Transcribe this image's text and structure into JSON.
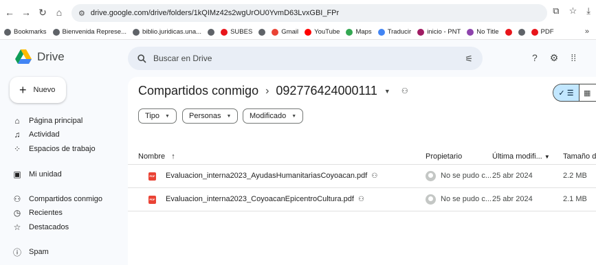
{
  "browser": {
    "url": "drive.google.com/drive/folders/1kQIMz42s2wgUrOU0YvmD63LvxGBI_FPr",
    "bookmarks": [
      {
        "label": "Bookmarks",
        "color": "#5f6368"
      },
      {
        "label": "Bienvenida Represe...",
        "color": "#5f6368"
      },
      {
        "label": "biblio.juridicas.una...",
        "color": "#5f6368"
      },
      {
        "label": "",
        "color": "#5f6368"
      },
      {
        "label": "SUBES",
        "color": "#e8151b"
      },
      {
        "label": "",
        "color": "#5f6368"
      },
      {
        "label": "Gmail",
        "color": "#ea4335"
      },
      {
        "label": "YouTube",
        "color": "#ff0000"
      },
      {
        "label": "Maps",
        "color": "#34a853"
      },
      {
        "label": "Traducir",
        "color": "#4285f4"
      },
      {
        "label": "inicio - PNT",
        "color": "#a01c63"
      },
      {
        "label": "No Title",
        "color": "#8e44ad"
      },
      {
        "label": "",
        "color": "#e8151b"
      },
      {
        "label": "",
        "color": "#5f6368"
      },
      {
        "label": "PDF",
        "color": "#e8151b"
      }
    ],
    "more": "»"
  },
  "header": {
    "app_name": "Drive",
    "search_placeholder": "Buscar en Drive"
  },
  "sidebar": {
    "new_label": "Nuevo",
    "items": [
      {
        "label": "Página principal",
        "icon": "home-icon",
        "glyph": "⌂"
      },
      {
        "label": "Actividad",
        "icon": "bell-icon",
        "glyph": "♫"
      },
      {
        "label": "Espacios de trabajo",
        "icon": "workspaces-icon",
        "glyph": "⁘"
      },
      {
        "label": "Mi unidad",
        "icon": "my-drive-icon",
        "glyph": "▣"
      },
      {
        "label": "Compartidos conmigo",
        "icon": "shared-icon",
        "glyph": "⚇"
      },
      {
        "label": "Recientes",
        "icon": "clock-icon",
        "glyph": "◷"
      },
      {
        "label": "Destacados",
        "icon": "star-icon",
        "glyph": "☆"
      },
      {
        "label": "Spam",
        "icon": "spam-icon",
        "glyph": "ⓘ"
      }
    ]
  },
  "main": {
    "breadcrumb_root": "Compartidos conmigo",
    "breadcrumb_folder": "092776424000111",
    "filters": [
      "Tipo",
      "Personas",
      "Modificado"
    ],
    "columns": {
      "name": "Nombre",
      "owner": "Propietario",
      "modified": "Última modifi...",
      "size": "Tamaño de"
    },
    "files": [
      {
        "name": "Evaluacion_interna2023_AyudasHumanitariasCoyoacan.pdf",
        "owner": "No se pudo c...",
        "modified": "25 abr 2024",
        "size": "2.2 MB"
      },
      {
        "name": "Evaluacion_interna2023_CoyoacanEpicentroCultura.pdf",
        "owner": "No se pudo c...",
        "modified": "25 abr 2024",
        "size": "2.1 MB"
      }
    ]
  },
  "colors": {
    "accent": "#c2e7ff",
    "search_bg": "#e9eef6",
    "pdf_red": "#ea4335"
  }
}
